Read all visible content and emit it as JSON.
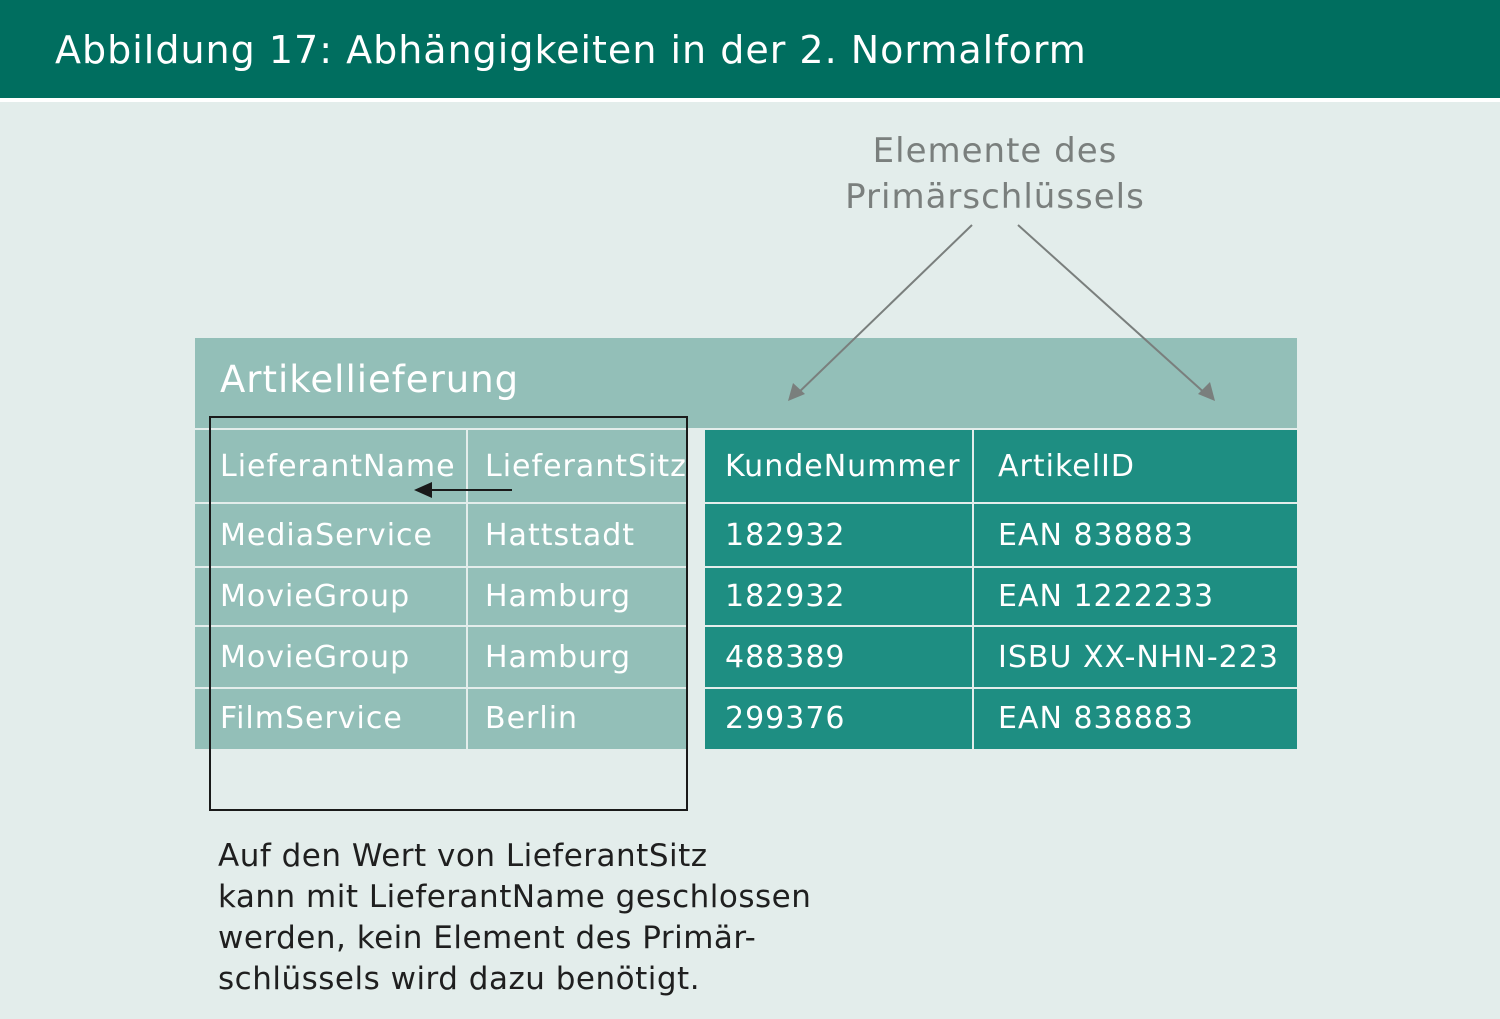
{
  "header": {
    "title": "Abbildung 17: Abhängigkeiten in der 2. Normalform"
  },
  "pk_label": {
    "line1": "Elemente des",
    "line2": "Primärschlüssels"
  },
  "table": {
    "name": "Artikellieferung",
    "columns": [
      "LieferantName",
      "LieferantSitz",
      "KundeNummer",
      "ArtikelID"
    ],
    "rows": [
      [
        "MediaService",
        "Hattstadt",
        "182932",
        "EAN 838883"
      ],
      [
        "MovieGroup",
        "Hamburg",
        "182932",
        "EAN 1222233"
      ],
      [
        "MovieGroup",
        "Hamburg",
        "488389",
        "ISBU XX-NHN-223"
      ],
      [
        "FilmService",
        "Berlin",
        "299376",
        "EAN 838883"
      ]
    ]
  },
  "caption": {
    "line1": "Auf den Wert von LieferantSitz",
    "line2": "kann mit LieferantName geschlossen",
    "line3": "werden, kein Element des Primär-",
    "line4": "schlüssels wird dazu benötigt."
  },
  "colors": {
    "header": "#006e5f",
    "background": "#e3edeb",
    "non_key_columns": "#93bfb8",
    "key_columns": "#1e8e82"
  }
}
